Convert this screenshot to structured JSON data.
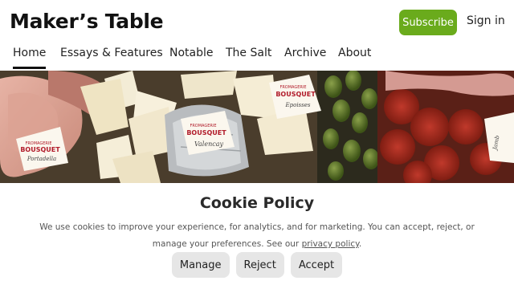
{
  "brand": {
    "name": "Maker’s Table"
  },
  "header": {
    "subscribe_label": "Subscribe",
    "signin_label": "Sign in",
    "accent_color": "#6aab1c"
  },
  "nav": {
    "active": "Home",
    "items": [
      "Home",
      "Essays & Features",
      "Notable",
      "The Salt",
      "Archive",
      "About"
    ]
  },
  "hero": {
    "labels": [
      {
        "brand": "BOUSQUET",
        "maker": "FROMAGERIE",
        "name": "Portadella"
      },
      {
        "brand": "BOUSQUET",
        "maker": "FROMAGERIE",
        "name": "Valencay"
      },
      {
        "brand": "BOUSQUET",
        "maker": "FROMAGERIE",
        "name": "Epoisses"
      },
      {
        "brand": "",
        "maker": "",
        "name": "Jamb"
      }
    ]
  },
  "cookie": {
    "title": "Cookie Policy",
    "body_prefix": "We use cookies to improve your experience, for analytics, and for marketing. You can accept, reject, or manage your preferences. See our ",
    "link_label": "privacy policy",
    "body_suffix": ".",
    "buttons": {
      "manage": "Manage",
      "reject": "Reject",
      "accept": "Accept"
    }
  }
}
